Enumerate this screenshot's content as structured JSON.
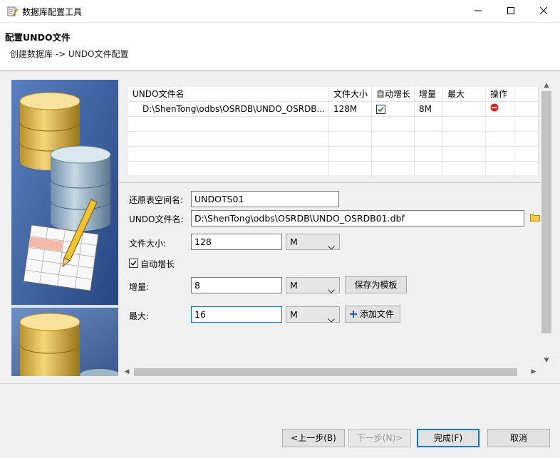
{
  "window": {
    "title": "数据库配置工具",
    "minimize_icon": "minimize-icon",
    "maximize_icon": "maximize-icon",
    "close_icon": "close-icon"
  },
  "header": {
    "title": "配置UNDO文件",
    "breadcrumb": "创建数据库 -> UNDO文件配置"
  },
  "table": {
    "columns": [
      "UNDO文件名",
      "文件大小",
      "自动增长",
      "增量",
      "最大",
      "操作"
    ],
    "rows": [
      {
        "file": "D:\\ShenTong\\odbs\\OSRDB\\UNDO_OSRDB...",
        "size": "128M",
        "autogrow": true,
        "increment": "8M",
        "max": "",
        "action_icon": "delete-icon"
      }
    ]
  },
  "form": {
    "tablespace_label": "还原表空间名:",
    "tablespace_value": "UNDOTS01",
    "file_label": "UNDO文件名:",
    "file_value": "D:\\ShenTong\\odbs\\OSRDB\\UNDO_OSRDB01.dbf",
    "size_label": "文件大小:",
    "size_value": "128",
    "size_unit": "M",
    "autogrow_label": "自动增长",
    "autogrow_checked": true,
    "increment_label": "增量:",
    "increment_value": "8",
    "increment_unit": "M",
    "save_template_label": "保存为模板",
    "max_label": "最大:",
    "max_value": "16",
    "max_unit": "M",
    "add_file_label": "添加文件"
  },
  "footer": {
    "prev_label": "<上一步(B)",
    "next_label": "下一步(N)>",
    "finish_label": "完成(F)",
    "cancel_label": "取消"
  },
  "colors": {
    "accent": "#0078d7",
    "delete_red": "#d9241b",
    "checkbox_green": "#1f7a1f"
  }
}
